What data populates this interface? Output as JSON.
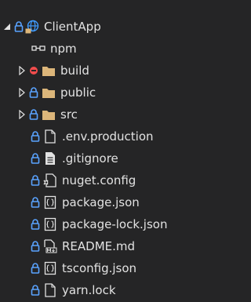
{
  "colors": {
    "background": "#252526",
    "text": "#e2e2e2",
    "lock": "#5aa3ff",
    "folder": "#dcb67a",
    "error": "#f14c4c",
    "globe": "#3f9bff"
  },
  "tree": {
    "project": {
      "label": "ClientApp",
      "icon": "web-project-icon"
    },
    "items": [
      {
        "label": "npm",
        "icon": "npm-package-icon"
      },
      {
        "label": "build",
        "icon": "folder-icon"
      },
      {
        "label": "public",
        "icon": "folder-icon"
      },
      {
        "label": "src",
        "icon": "folder-icon"
      },
      {
        "label": ".env.production",
        "icon": "file-icon"
      },
      {
        "label": ".gitignore",
        "icon": "text-file-icon"
      },
      {
        "label": "nuget.config",
        "icon": "config-file-icon"
      },
      {
        "label": "package.json",
        "icon": "json-file-icon"
      },
      {
        "label": "package-lock.json",
        "icon": "json-file-icon"
      },
      {
        "label": "README.md",
        "icon": "markdown-file-icon"
      },
      {
        "label": "tsconfig.json",
        "icon": "json-file-icon"
      },
      {
        "label": "yarn.lock",
        "icon": "file-icon"
      }
    ]
  }
}
